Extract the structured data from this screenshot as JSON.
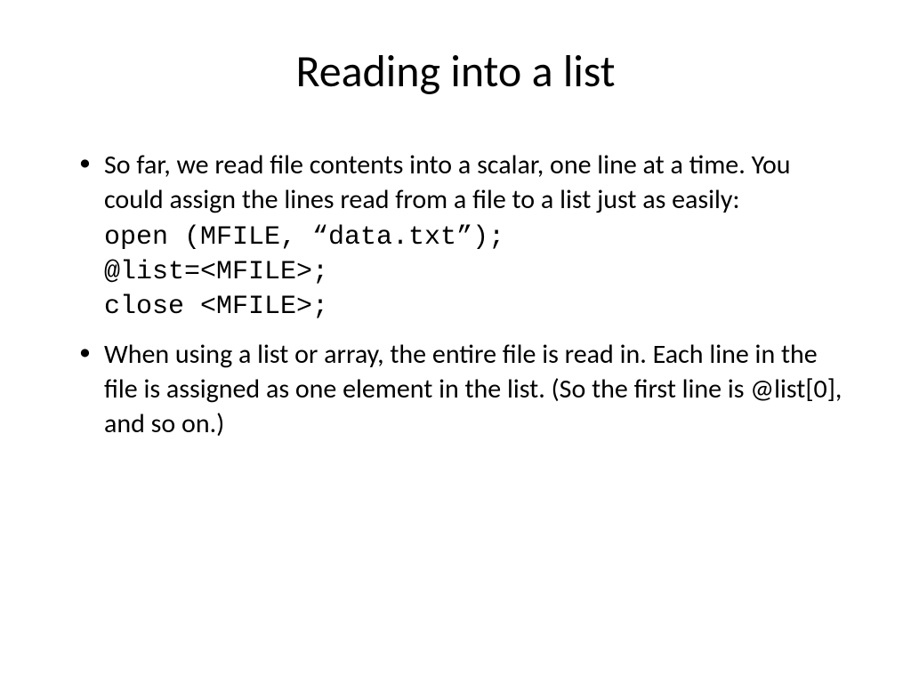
{
  "title": "Reading into a list",
  "bullets": [
    {
      "text": "So far, we read file contents into a scalar, one line at a time.  You could assign the lines read from a file to a list just as easily:",
      "code": [
        "open (MFILE, “data.txt”);",
        "@list=<MFILE>;",
        "close <MFILE>;"
      ]
    },
    {
      "text": "When using a list or array, the entire file is read in. Each line in the file is assigned as one element in the list. (So the first line is @list[0], and so on.)"
    }
  ]
}
